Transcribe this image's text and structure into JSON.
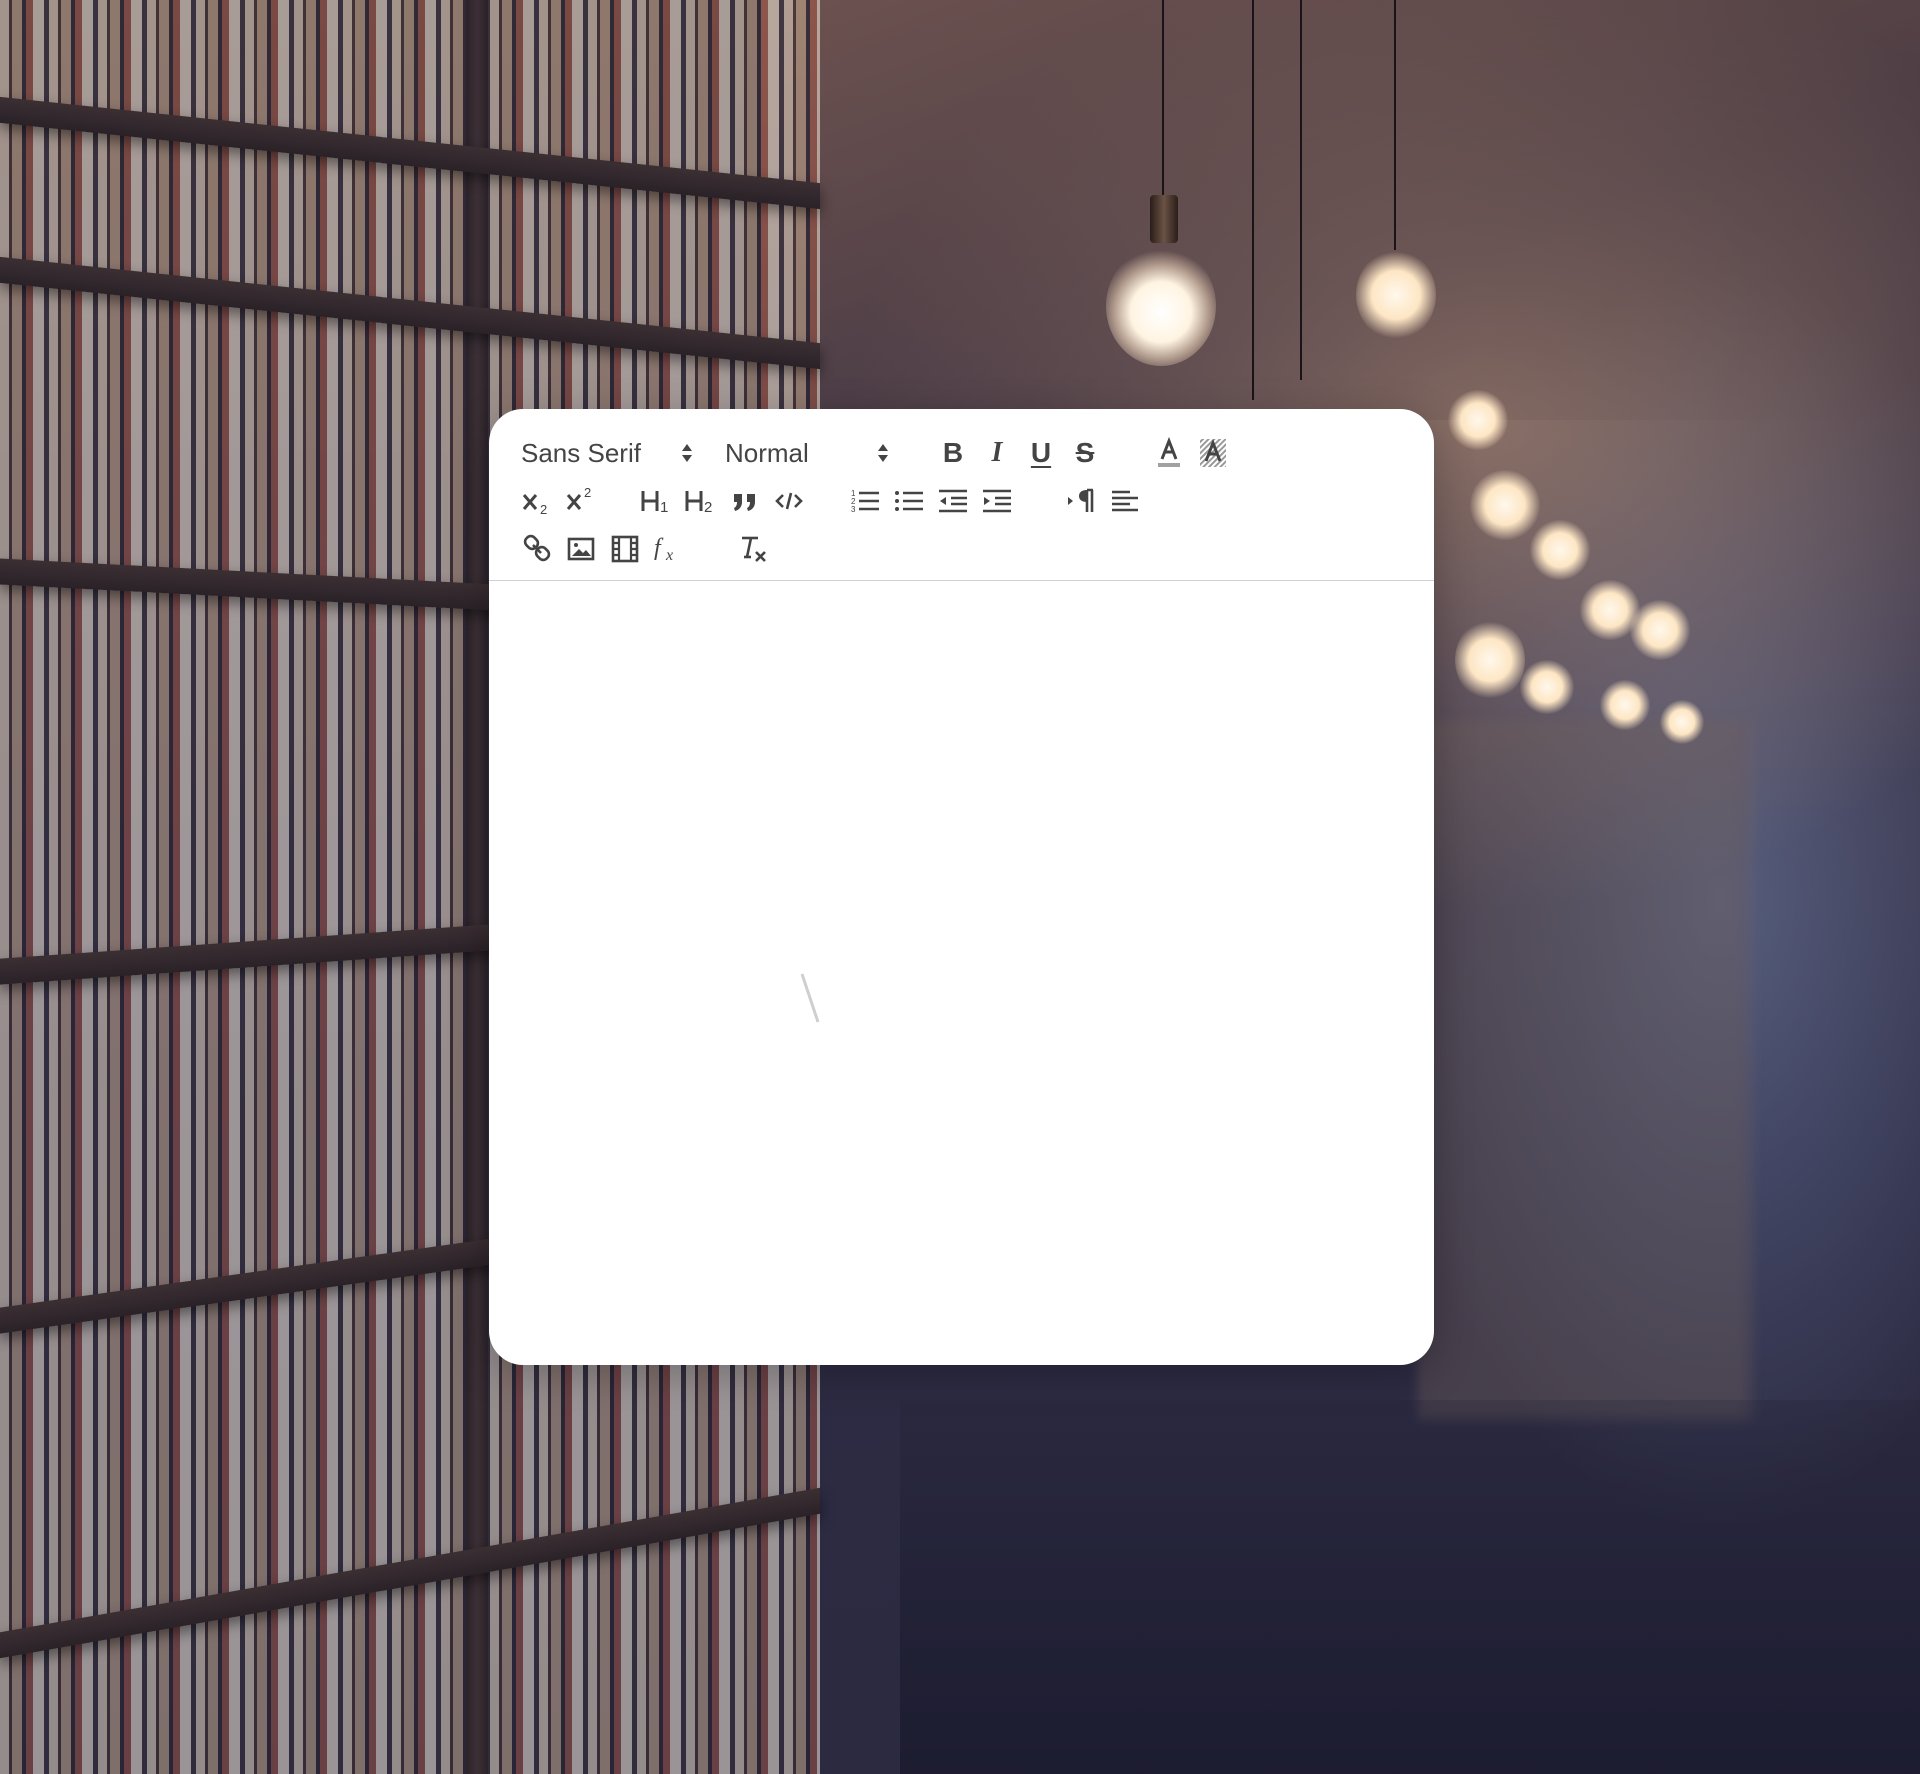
{
  "toolbar": {
    "font_picker": {
      "selected": "Sans Serif"
    },
    "size_picker": {
      "selected": "Normal"
    },
    "buttons": {
      "bold": "B",
      "italic": "I",
      "underline": "U",
      "strike": "S",
      "header1": "H1",
      "header2": "H2"
    }
  },
  "editor": {
    "placeholder": "",
    "content": ""
  },
  "colors": {
    "icon": "#444444",
    "editor_bg": "#ffffff",
    "toolbar_border": "#d1d1d1"
  },
  "icons": [
    "subscript-icon",
    "superscript-icon",
    "header-1-icon",
    "header-2-icon",
    "blockquote-icon",
    "code-block-icon",
    "ordered-list-icon",
    "bullet-list-icon",
    "outdent-icon",
    "indent-icon",
    "rtl-direction-icon",
    "align-icon",
    "link-icon",
    "image-icon",
    "video-icon",
    "formula-icon",
    "clear-format-icon",
    "text-color-icon",
    "background-color-icon"
  ]
}
